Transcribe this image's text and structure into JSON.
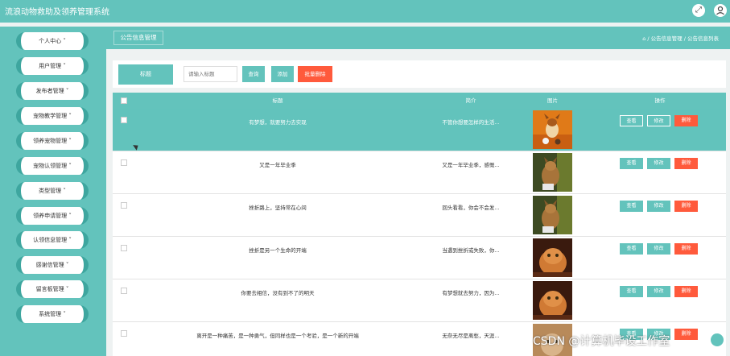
{
  "app": {
    "title": "流浪动物救助及领养管理系统"
  },
  "topbar": {
    "fullscreen_icon": "expand-icon",
    "user_icon": "user-icon"
  },
  "sidebar": {
    "items": [
      {
        "label": "个人中心 ˅"
      },
      {
        "label": "用户管理 ˅"
      },
      {
        "label": "发布者管理 ˅"
      },
      {
        "label": "宠物教学管理 ˅"
      },
      {
        "label": "领养宠物管理 ˅"
      },
      {
        "label": "宠物认领管理 ˅"
      },
      {
        "label": "类型管理 ˅"
      },
      {
        "label": "领养申请管理 ˅"
      },
      {
        "label": "认领信息管理 ˅"
      },
      {
        "label": "感谢信管理 ˅"
      },
      {
        "label": "留言板管理 ˅"
      },
      {
        "label": "系统管理 ˅"
      }
    ]
  },
  "breadcrumb": {
    "current_tab": "公告信息管理",
    "home_icon": "home-icon",
    "path": "/ 公告信息管理 / 公告信息列表"
  },
  "search": {
    "label": "标题",
    "placeholder": "请输入标题",
    "search_button": "查询",
    "add_button": "添加",
    "batch_delete_button": "批量删除"
  },
  "table": {
    "headers": {
      "title": "标题",
      "summary": "简介",
      "image": "图片",
      "actions": "操作"
    },
    "action_labels": {
      "view": "查看",
      "edit": "修改",
      "delete": "删除"
    },
    "rows": [
      {
        "title": "有梦想，就要努力去实现",
        "summary": "不管你想要怎样的生活...",
        "image": "dog-photo",
        "highlighted": true
      },
      {
        "title": "又是一年毕业季",
        "summary": "又是一年毕业季，感慨...",
        "image": "cat-photo",
        "highlighted": false
      },
      {
        "title": "挫折路上，坚持常在心间",
        "summary": "回头看看，你会不会发...",
        "image": "cat-photo",
        "highlighted": false
      },
      {
        "title": "挫折是另一个生命的开端",
        "summary": "当遇到挫折或失败，你...",
        "image": "persian-cat-photo",
        "highlighted": false
      },
      {
        "title": "你要去相信，没有到不了的明天",
        "summary": "有梦想就去努力，因为...",
        "image": "persian-cat-photo",
        "highlighted": false
      },
      {
        "title": "离开是一种痛苦，是一种勇气，但同样也是一个考验，是一个新的开端",
        "summary": "无奈无尽是离愁，天涯...",
        "image": "cat-photo",
        "highlighted": false
      }
    ]
  },
  "watermark": {
    "text": "CSDN @计算机毕设工作室"
  },
  "colors": {
    "primary": "#63c3bc",
    "danger": "#ff5a3c",
    "content_bg": "#eef2f2"
  }
}
